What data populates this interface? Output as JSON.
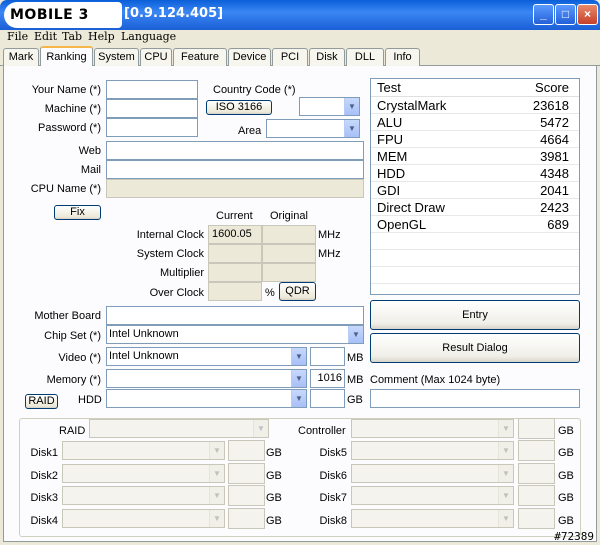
{
  "window": {
    "logo_text": "MOBILE 3",
    "version": "[0.9.124.405]",
    "controls": {
      "minimize": "_",
      "maximize": "□",
      "close": "×"
    }
  },
  "menu": [
    "File",
    "Edit",
    "Tab",
    "Help",
    "Language"
  ],
  "tabs": [
    "Mark",
    "Ranking",
    "System",
    "CPU",
    "Feature",
    "Device",
    "PCI",
    "Disk",
    "DLL",
    "Info"
  ],
  "active_tab": "Ranking",
  "form": {
    "your_name": {
      "label": "Your Name (*)",
      "value": ""
    },
    "machine": {
      "label": "Machine (*)",
      "value": ""
    },
    "password": {
      "label": "Password (*)",
      "value": ""
    },
    "country_code": {
      "label": "Country Code (*)",
      "button": "ISO 3166",
      "value": ""
    },
    "area": {
      "label": "Area",
      "value": ""
    },
    "web": {
      "label": "Web",
      "value": ""
    },
    "mail": {
      "label": "Mail",
      "value": ""
    },
    "cpu_name": {
      "label": "CPU Name (*)",
      "value": ""
    },
    "fix_button": "Fix",
    "clock": {
      "header_current": "Current",
      "header_original": "Original",
      "internal_clock": {
        "label": "Internal Clock",
        "current": "1600.05",
        "original": "",
        "unit": "MHz"
      },
      "system_clock": {
        "label": "System Clock",
        "current": "",
        "original": "",
        "unit": "MHz"
      },
      "multiplier": {
        "label": "Multiplier",
        "current": "",
        "original": ""
      },
      "over_clock": {
        "label": "Over Clock",
        "current": "",
        "unit": "%",
        "qdr": "QDR"
      }
    },
    "mother_board": {
      "label": "Mother Board",
      "value": ""
    },
    "chip_set": {
      "label": "Chip Set (*)",
      "value": "Intel Unknown"
    },
    "video": {
      "label": "Video (*)",
      "value": "Intel Unknown",
      "size": "",
      "unit": "MB"
    },
    "memory": {
      "label": "Memory (*)",
      "value": "",
      "size": "1016",
      "unit": "MB"
    },
    "raid_button": "RAID",
    "hdd": {
      "label": "HDD",
      "value": "",
      "size": "",
      "unit": "GB"
    },
    "comment": {
      "label": "Comment (Max 1024 byte)",
      "value": ""
    }
  },
  "scores": {
    "header_test": "Test",
    "header_score": "Score",
    "rows": [
      {
        "test": "CrystalMark",
        "score": "23618"
      },
      {
        "test": "ALU",
        "score": "5472"
      },
      {
        "test": "FPU",
        "score": "4664"
      },
      {
        "test": "MEM",
        "score": "3981"
      },
      {
        "test": "HDD",
        "score": "4348"
      },
      {
        "test": "GDI",
        "score": "2041"
      },
      {
        "test": "Direct Draw",
        "score": "2423"
      },
      {
        "test": "OpenGL",
        "score": "689"
      }
    ]
  },
  "actions": {
    "entry": "Entry",
    "result_dialog": "Result Dialog"
  },
  "raid_group": {
    "raid_label": "RAID",
    "controller_label": "Controller",
    "unit": "GB",
    "disks_left": [
      "Disk1",
      "Disk2",
      "Disk3",
      "Disk4"
    ],
    "disks_right": [
      "Disk5",
      "Disk6",
      "Disk7",
      "Disk8"
    ]
  },
  "watermark": "#72389"
}
